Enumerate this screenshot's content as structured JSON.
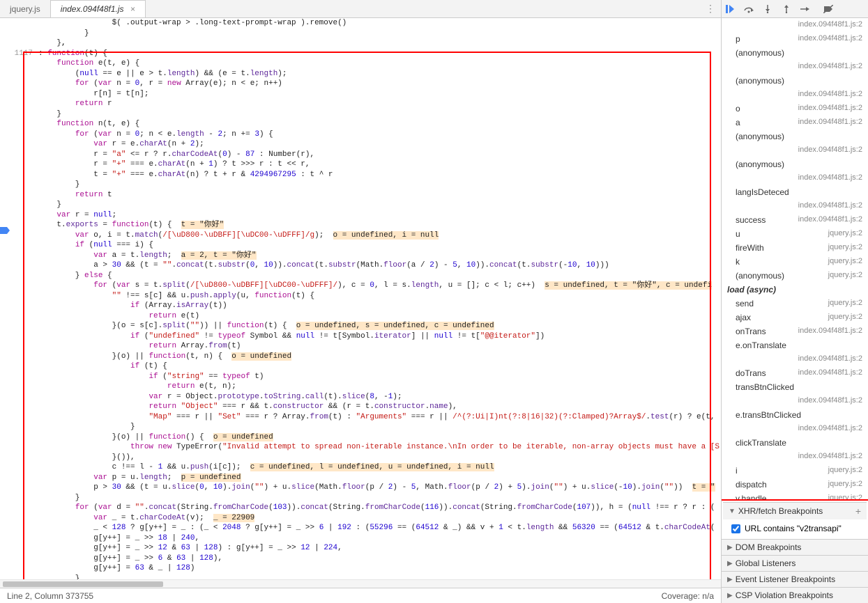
{
  "tabs": {
    "tab1": "jquery.js",
    "tab2": "index.094f48f1.js",
    "close": "×",
    "menu": "⋮"
  },
  "gutter": {
    "line": "1117"
  },
  "code": [
    {
      "i": 3,
      "h": "    $( .output-wrap > .long-text-prompt-wrap ).remove()"
    },
    {
      "i": 2,
      "h": "  }"
    },
    {
      "i": 1,
      "h": "}<span class='op'>,</span>"
    },
    {
      "i": 0,
      "h": ": <span class='kw'>function</span>(t) {"
    },
    {
      "i": 1,
      "h": "<span class='kw'>function</span> e(t, e) {"
    },
    {
      "i": 2,
      "h": "(<span class='num'>null</span> == e || e > t.<span class='prop'>length</span>) && (e = t.<span class='prop'>length</span>);"
    },
    {
      "i": 2,
      "h": "<span class='kw'>for</span> (<span class='kw'>var</span> n = <span class='num'>0</span>, r = <span class='kw'>new</span> Array(e); n < e; n++)"
    },
    {
      "i": 3,
      "h": "r[n] = t[n];"
    },
    {
      "i": 2,
      "h": "<span class='kw'>return</span> r"
    },
    {
      "i": 1,
      "h": "}"
    },
    {
      "i": 1,
      "h": "<span class='kw'>function</span> n(t, e) {"
    },
    {
      "i": 2,
      "h": "<span class='kw'>for</span> (<span class='kw'>var</span> n = <span class='num'>0</span>; n < e.<span class='prop'>length</span> - <span class='num'>2</span>; n += <span class='num'>3</span>) {"
    },
    {
      "i": 3,
      "h": "<span class='kw'>var</span> r = e.<span class='prop'>charAt</span>(n + <span class='num'>2</span>);"
    },
    {
      "i": 3,
      "h": "r = <span class='str'>\"a\"</span> <= r ? r.<span class='prop'>charCodeAt</span>(<span class='num'>0</span>) - <span class='num'>87</span> : Number(r),"
    },
    {
      "i": 3,
      "h": "r = <span class='str'>\"+\"</span> === e.<span class='prop'>charAt</span>(n + <span class='num'>1</span>) ? t >>> r : t << r,"
    },
    {
      "i": 3,
      "h": "t = <span class='str'>\"+\"</span> === e.<span class='prop'>charAt</span>(n) ? t + r & <span class='num'>4294967295</span> : t ^ r"
    },
    {
      "i": 2,
      "h": "}"
    },
    {
      "i": 2,
      "h": "<span class='kw'>return</span> t"
    },
    {
      "i": 1,
      "h": "}"
    },
    {
      "i": 1,
      "h": "<span class='kw'>var</span> r = <span class='num'>null</span>;"
    },
    {
      "i": 1,
      "h": "t.<span class='prop'>exports</span> = <span class='kw'>function</span>(t) {  <span class='highlight'>t = \"你好\"</span>"
    },
    {
      "i": 2,
      "h": "<span class='kw'>var</span> o, i = t.<span class='prop'>match</span>(<span class='regex'>/[\\uD800-\\uDBFF][\\uDC00-\\uDFFF]/g</span>);  <span class='highlight'>o = undefined, i = null</span>"
    },
    {
      "i": 2,
      "h": "<span class='kw'>if</span> (<span class='num'>null</span> === i) {"
    },
    {
      "i": 3,
      "h": "<span class='kw'>var</span> a = t.<span class='prop'>length</span>;  <span class='highlight'>a = 2, t = \"你好\"</span>"
    },
    {
      "i": 3,
      "h": "a > <span class='num'>30</span> && (t = <span class='str'>\"\"</span>.<span class='prop'>concat</span>(t.<span class='prop'>substr</span>(<span class='num'>0</span>, <span class='num'>10</span>)).<span class='prop'>concat</span>(t.<span class='prop'>substr</span>(Math.<span class='prop'>floor</span>(a / <span class='num'>2</span>) - <span class='num'>5</span>, <span class='num'>10</span>)).<span class='prop'>concat</span>(t.<span class='prop'>substr</span>(-<span class='num'>10</span>, <span class='num'>10</span>)))"
    },
    {
      "i": 2,
      "h": "} <span class='kw'>else</span> {"
    },
    {
      "i": 3,
      "h": "<span class='kw'>for</span> (<span class='kw'>var</span> s = t.<span class='prop'>split</span>(<span class='regex'>/[\\uD800-\\uDBFF][\\uDC00-\\uDFFF]/</span>), c = <span class='num'>0</span>, l = s.<span class='prop'>length</span>, u = []; c < l; c++)  <span class='highlight'>s = undefined, t = \"你好\", c = undefi</span>"
    },
    {
      "i": 4,
      "h": "<span class='str'>\"\"</span> !== s[c] && u.<span class='prop'>push</span>.<span class='prop'>apply</span>(u, <span class='kw'>function</span>(t) {"
    },
    {
      "i": 5,
      "h": "<span class='kw'>if</span> (Array.<span class='prop'>isArray</span>(t))"
    },
    {
      "i": 6,
      "h": "<span class='kw'>return</span> e(t)"
    },
    {
      "i": 4,
      "h": "}(o = s[c].<span class='prop'>split</span>(<span class='str'>\"\"</span>)) || <span class='kw'>function</span>(t) {  <span class='highlight'>o = undefined, s = undefined, c = undefined</span>"
    },
    {
      "i": 5,
      "h": "<span class='kw'>if</span> (<span class='str'>\"undefined\"</span> != <span class='kw'>typeof</span> Symbol && <span class='num'>null</span> != t[Symbol.<span class='prop'>iterator</span>] || <span class='num'>null</span> != t[<span class='str'>\"@@iterator\"</span>])"
    },
    {
      "i": 6,
      "h": "<span class='kw'>return</span> Array.<span class='prop'>from</span>(t)"
    },
    {
      "i": 4,
      "h": "}(o) || <span class='kw'>function</span>(t, n) {  <span class='highlight'>o = undefined</span>"
    },
    {
      "i": 5,
      "h": "<span class='kw'>if</span> (t) {"
    },
    {
      "i": 6,
      "h": "<span class='kw'>if</span> (<span class='str'>\"string\"</span> == <span class='kw'>typeof</span> t)"
    },
    {
      "i": 7,
      "h": "<span class='kw'>return</span> e(t, n);"
    },
    {
      "i": 6,
      "h": "<span class='kw'>var</span> r = Object.<span class='prop'>prototype</span>.<span class='prop'>toString</span>.<span class='prop'>call</span>(t).<span class='prop'>slice</span>(<span class='num'>8</span>, -<span class='num'>1</span>);"
    },
    {
      "i": 6,
      "h": "<span class='kw'>return</span> <span class='str'>\"Object\"</span> === r && t.<span class='prop'>constructor</span> && (r = t.<span class='prop'>constructor</span>.<span class='prop'>name</span>),"
    },
    {
      "i": 6,
      "h": "<span class='str'>\"Map\"</span> === r || <span class='str'>\"Set\"</span> === r ? Array.<span class='prop'>from</span>(t) : <span class='str'>\"Arguments\"</span> === r || <span class='regex'>/^(?:Ui|I)nt(?:8|16|32)(?:Clamped)?Array$/</span>.<span class='prop'>test</span>(r) ? e(t,"
    },
    {
      "i": 5,
      "h": "}"
    },
    {
      "i": 4,
      "h": "}(o) || <span class='kw'>function</span>() {  <span class='highlight'>o = undefined</span>"
    },
    {
      "i": 5,
      "h": "<span class='kw'>throw new</span> TypeError(<span class='str'>\"Invalid attempt to spread non-iterable instance.\\nIn order to be iterable, non-array objects must have a [S</span>"
    },
    {
      "i": 4,
      "h": "}()),"
    },
    {
      "i": 4,
      "h": "c !== l - <span class='num'>1</span> && u.<span class='prop'>push</span>(i[c]);  <span class='highlight'>c = undefined, l = undefined, u = undefined, i = null</span>"
    },
    {
      "i": 3,
      "h": "<span class='kw'>var</span> p = u.<span class='prop'>length</span>;  <span class='highlight'>p = undefined</span>"
    },
    {
      "i": 3,
      "h": "p > <span class='num'>30</span> && (t = u.<span class='prop'>slice</span>(<span class='num'>0</span>, <span class='num'>10</span>).<span class='prop'>join</span>(<span class='str'>\"\"</span>) + u.<span class='prop'>slice</span>(Math.<span class='prop'>floor</span>(p / <span class='num'>2</span>) - <span class='num'>5</span>, Math.<span class='prop'>floor</span>(p / <span class='num'>2</span>) + <span class='num'>5</span>).<span class='prop'>join</span>(<span class='str'>\"\"</span>) + u.<span class='prop'>slice</span>(-<span class='num'>10</span>).<span class='prop'>join</span>(<span class='str'>\"\"</span>))  <span class='highlight'>t = \"</span>"
    },
    {
      "i": 2,
      "h": "}"
    },
    {
      "i": 2,
      "h": "<span class='kw'>for</span> (<span class='kw'>var</span> d = <span class='str'>\"\"</span>.<span class='prop'>concat</span>(String.<span class='prop'>fromCharCode</span>(<span class='num'>103</span>)).<span class='prop'>concat</span>(String.<span class='prop'>fromCharCode</span>(<span class='num'>116</span>)).<span class='prop'>concat</span>(String.<span class='prop'>fromCharCode</span>(<span class='num'>107</span>)), h = (<span class='num'>null</span> !== r ? r : ("
    },
    {
      "i": 3,
      "h": "<span class='kw'>var</span> _ = t.<span class='prop'>charCodeAt</span>(v);  <span class='highlight'>_ = 22909</span>"
    },
    {
      "i": 3,
      "h": "_ < <span class='num'>128</span> ? g[y++] = _ : (_ < <span class='num'>2048</span> ? g[y++] = _ >> <span class='num'>6</span> | <span class='num'>192</span> : (<span class='num'>55296</span> == (<span class='num'>64512</span> & _) && v + <span class='num'>1</span> < t.<span class='prop'>length</span> && <span class='num'>56320</span> == (<span class='num'>64512</span> & t.<span class='prop'>charCodeAt</span>("
    },
    {
      "i": 3,
      "h": "g[y++] = _ >> <span class='num'>18</span> | <span class='num'>240</span>,"
    },
    {
      "i": 3,
      "h": "g[y++] = _ >> <span class='num'>12</span> & <span class='num'>63</span> | <span class='num'>128</span>) : g[y++] = _ >> <span class='num'>12</span> | <span class='num'>224</span>,"
    },
    {
      "i": 3,
      "h": "g[y++] = _ >> <span class='num'>6</span> & <span class='num'>63</span> | <span class='num'>128</span>),"
    },
    {
      "i": 3,
      "h": "g[y++] = <span class='num'>63</span> & _ | <span class='num'>128</span>)"
    },
    {
      "i": 2,
      "h": "}"
    }
  ],
  "status": {
    "left": "Line 2, Column 373755",
    "right": "Coverage: n/a"
  },
  "callstack": [
    {
      "fn": "",
      "src": "index.094f48f1.js:2",
      "sub": true
    },
    {
      "fn": "p",
      "src": "index.094f48f1.js:2"
    },
    {
      "fn": "(anonymous)",
      "src": ""
    },
    {
      "fn": "",
      "src": "index.094f48f1.js:2",
      "sub": true
    },
    {
      "fn": "(anonymous)",
      "src": ""
    },
    {
      "fn": "",
      "src": "index.094f48f1.js:2",
      "sub": true
    },
    {
      "fn": "o",
      "src": "index.094f48f1.js:2"
    },
    {
      "fn": "a",
      "src": "index.094f48f1.js:2"
    },
    {
      "fn": "(anonymous)",
      "src": ""
    },
    {
      "fn": "",
      "src": "index.094f48f1.js:2",
      "sub": true
    },
    {
      "fn": "(anonymous)",
      "src": ""
    },
    {
      "fn": "",
      "src": "index.094f48f1.js:2",
      "sub": true
    },
    {
      "fn": "langIsDeteced",
      "src": ""
    },
    {
      "fn": "",
      "src": "index.094f48f1.js:2",
      "sub": true
    },
    {
      "fn": "success",
      "src": "index.094f48f1.js:2"
    },
    {
      "fn": "u",
      "src": "jquery.js:2"
    },
    {
      "fn": "fireWith",
      "src": "jquery.js:2"
    },
    {
      "fn": "k",
      "src": "jquery.js:2"
    },
    {
      "fn": "(anonymous)",
      "src": "jquery.js:2"
    },
    {
      "async": "load (async)"
    },
    {
      "fn": "send",
      "src": "jquery.js:2"
    },
    {
      "fn": "ajax",
      "src": "jquery.js:2"
    },
    {
      "fn": "onTrans",
      "src": "index.094f48f1.js:2"
    },
    {
      "fn": "e.onTranslate",
      "src": ""
    },
    {
      "fn": "",
      "src": "index.094f48f1.js:2",
      "sub": true
    },
    {
      "fn": "doTrans",
      "src": "index.094f48f1.js:2"
    },
    {
      "fn": "transBtnClicked",
      "src": ""
    },
    {
      "fn": "",
      "src": "index.094f48f1.js:2",
      "sub": true
    },
    {
      "fn": "e.transBtnClicked",
      "src": ""
    },
    {
      "fn": "",
      "src": "index.094f48f1.js:2",
      "sub": true
    },
    {
      "fn": "clickTranslate",
      "src": ""
    },
    {
      "fn": "",
      "src": "index.094f48f1.js:2",
      "sub": true
    },
    {
      "fn": "i",
      "src": "jquery.js:2"
    },
    {
      "fn": "dispatch",
      "src": "jquery.js:2"
    },
    {
      "fn": "v.handle",
      "src": "jquery.js:2"
    }
  ],
  "panels": {
    "xhr": {
      "title": "XHR/fetch Breakpoints",
      "item": "URL contains \"v2transapi\"",
      "checked": true
    },
    "dom": {
      "title": "DOM Breakpoints"
    },
    "global": {
      "title": "Global Listeners"
    },
    "event": {
      "title": "Event Listener Breakpoints"
    },
    "csp": {
      "title": "CSP Violation Breakpoints"
    }
  }
}
